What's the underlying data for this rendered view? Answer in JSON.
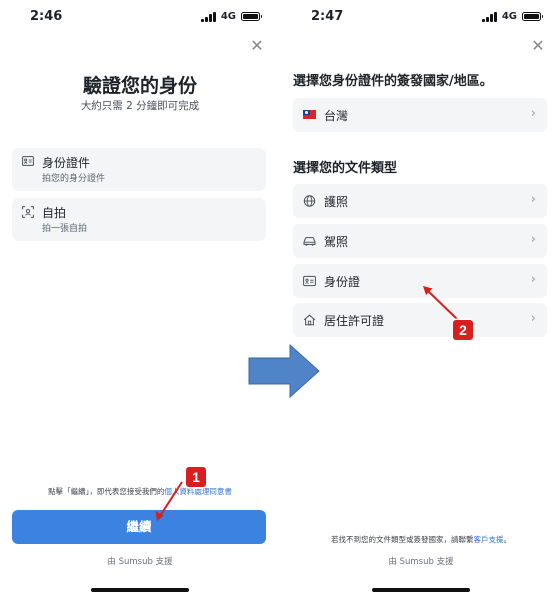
{
  "left_screen": {
    "status": {
      "time": "2:46",
      "network": "4G"
    },
    "title": "驗證您的身份",
    "subtitle": "大約只需 2 分鐘即可完成",
    "options": [
      {
        "icon": "id-card-icon",
        "title": "身份證件",
        "subtitle": "拍您的身分證件"
      },
      {
        "icon": "selfie-icon",
        "title": "自拍",
        "subtitle": "拍一張自拍"
      }
    ],
    "consent_prefix": "點擊「繼續」，即代表您接受我們的",
    "consent_link": "個人資料處理同意書",
    "continue_label": "繼續",
    "footer": "由 Sumsub 支援"
  },
  "right_screen": {
    "status": {
      "time": "2:47",
      "network": "4G"
    },
    "country_heading": "選擇您身份證件的簽發國家/地區。",
    "country": {
      "icon": "taiwan-flag-icon",
      "label": "台灣"
    },
    "doc_heading": "選擇您的文件類型",
    "documents": [
      {
        "icon": "globe-icon",
        "label": "護照"
      },
      {
        "icon": "car-icon",
        "label": "駕照"
      },
      {
        "icon": "id-card-icon",
        "label": "身份證"
      },
      {
        "icon": "home-icon",
        "label": "居住許可證"
      }
    ],
    "help_prefix": "若找不到您的文件類型或簽發國家，請聯繫",
    "help_link": "客戶支援",
    "help_suffix": "。",
    "footer": "由 Sumsub 支援"
  },
  "annotations": {
    "badge_1": "1",
    "badge_2": "2",
    "colors": {
      "marker": "#d81e1e",
      "arrow_fill": "#4f84c8",
      "accent": "#3c82e0"
    }
  }
}
